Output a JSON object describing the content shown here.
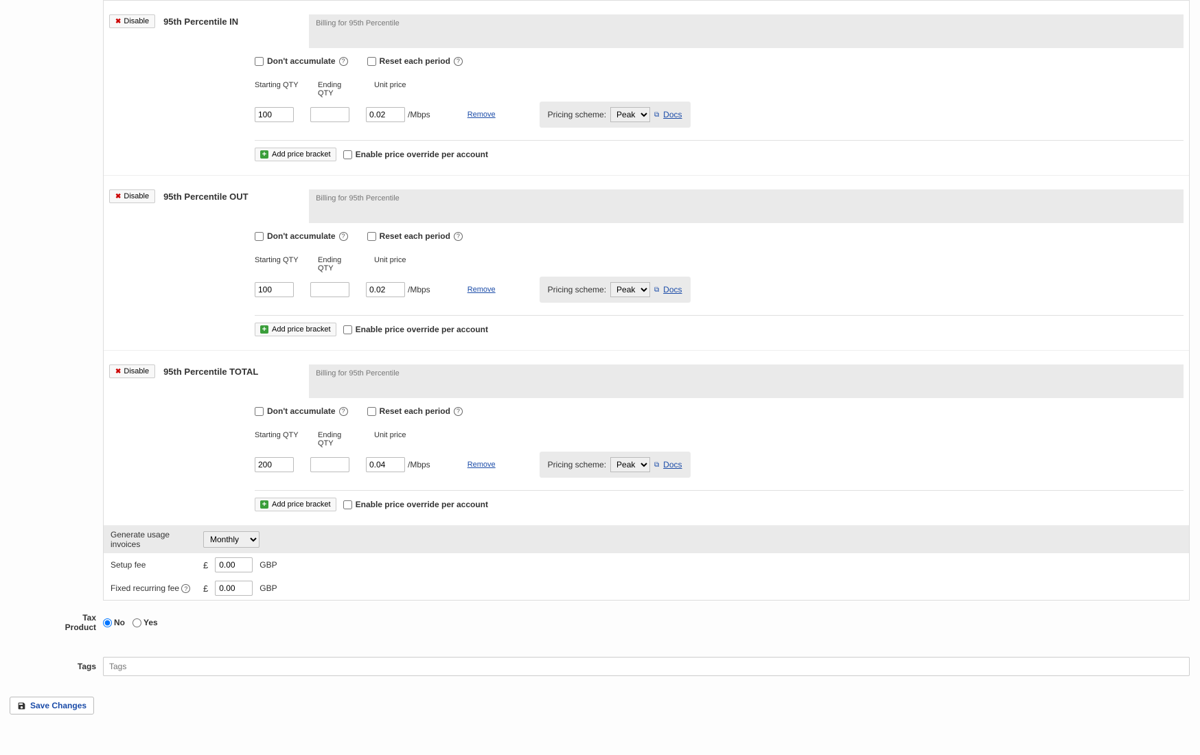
{
  "common": {
    "disable_label": "Disable",
    "billing_desc": "Billing for 95th Percentile",
    "dont_accumulate": "Don't accumulate",
    "reset_each_period": "Reset each period",
    "starting_qty": "Starting QTY",
    "ending_qty": "Ending QTY",
    "unit_price": "Unit price",
    "unit_suffix": "/Mbps",
    "remove": "Remove",
    "pricing_scheme": "Pricing scheme:",
    "peak_option": "Peak",
    "docs": "Docs",
    "add_price_bracket": "Add price bracket",
    "enable_override": "Enable price override per account"
  },
  "sections": [
    {
      "title": "95th Percentile IN",
      "starting": "100",
      "ending": "",
      "price": "0.02"
    },
    {
      "title": "95th Percentile OUT",
      "starting": "100",
      "ending": "",
      "price": "0.02"
    },
    {
      "title": "95th Percentile TOTAL",
      "starting": "200",
      "ending": "",
      "price": "0.04"
    }
  ],
  "footer": {
    "generate_invoices_label": "Generate usage invoices",
    "generate_invoices_value": "Monthly",
    "setup_fee_label": "Setup fee",
    "setup_fee_value": "0.00",
    "fixed_recurring_label": "Fixed recurring fee",
    "fixed_recurring_value": "0.00",
    "currency_symbol": "£",
    "currency_code": "GBP"
  },
  "tax_product": {
    "label": "Tax Product",
    "no": "No",
    "yes": "Yes"
  },
  "tags": {
    "label": "Tags",
    "placeholder": "Tags"
  },
  "save_button": "Save Changes"
}
